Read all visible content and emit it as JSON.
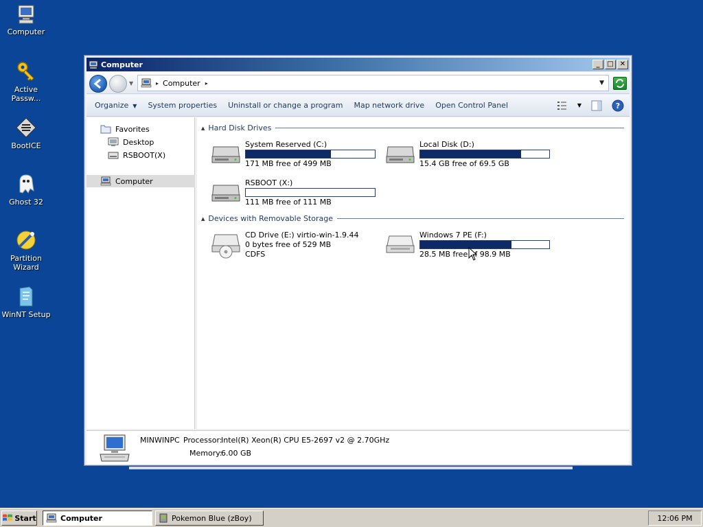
{
  "desktop": {
    "icons": [
      {
        "label": "Computer",
        "icon": "computer-icon"
      },
      {
        "label": "Active\nPassw...",
        "icon": "key-icon"
      },
      {
        "label": "BootICE",
        "icon": "bootice-icon"
      },
      {
        "label": "Ghost 32",
        "icon": "ghost-icon"
      },
      {
        "label": "Partition\nWizard",
        "icon": "partition-wizard-icon"
      },
      {
        "label": "WinNT Setup",
        "icon": "winnt-setup-icon"
      }
    ]
  },
  "window": {
    "title": "Computer",
    "address": {
      "crumb": "Computer"
    },
    "commands": {
      "organize": "Organize",
      "system_properties": "System properties",
      "uninstall": "Uninstall or change a program",
      "map_drive": "Map network drive",
      "control_panel": "Open Control Panel"
    },
    "nav": {
      "favorites": "Favorites",
      "desktop": "Desktop",
      "rsboot": "RSBOOT(X)",
      "computer": "Computer"
    },
    "groups": {
      "hdd": "Hard Disk Drives",
      "removable": "Devices with Removable Storage"
    },
    "drives": {
      "c": {
        "name": "System Reserved (C:)",
        "free": "171 MB free of 499 MB",
        "used_fraction": 0.66
      },
      "d": {
        "name": "Local Disk (D:)",
        "free": "15.4 GB free of 69.5 GB",
        "used_fraction": 0.78
      },
      "x": {
        "name": "RSBOOT (X:)",
        "free": "111 MB free of 111 MB",
        "used_fraction": 0.0
      },
      "e": {
        "name": "CD Drive (E:) virtio-win-1.9.44",
        "free": "0 bytes free of 529 MB",
        "fs": "CDFS"
      },
      "f": {
        "name": "Windows 7 PE (F:)",
        "free": "28.5 MB free of 98.9 MB",
        "used_fraction": 0.71
      }
    },
    "details": {
      "pc_name": "MINWINPC",
      "processor_label": "Processor:",
      "processor": "Intel(R) Xeon(R) CPU E5-2697 v2 @ 2.70GHz",
      "memory_label": "Memory:",
      "memory": "6.00 GB"
    }
  },
  "taskbar": {
    "start": "Start",
    "tasks": [
      {
        "label": "Computer",
        "active": true
      },
      {
        "label": "Pokemon Blue (zBoy)",
        "active": false
      }
    ],
    "clock": "12:06 PM"
  },
  "colors": {
    "desktop": "#0b4597",
    "title_gradient_start": "#0a246a",
    "drive_bar_fill": "#0e2a66"
  }
}
